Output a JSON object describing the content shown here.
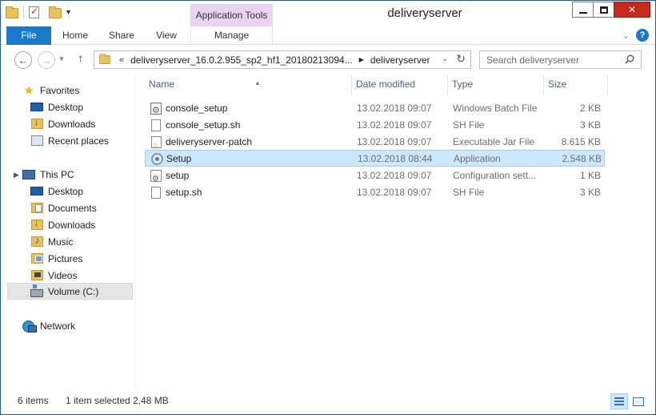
{
  "window": {
    "title": "deliveryserver",
    "context_tab_header": "Application Tools"
  },
  "ribbon": {
    "tabs": [
      {
        "label": "File"
      },
      {
        "label": "Home"
      },
      {
        "label": "Share"
      },
      {
        "label": "View"
      },
      {
        "label": "Manage"
      }
    ]
  },
  "navbar": {
    "breadcrumb_lead": "«",
    "breadcrumbs": [
      {
        "label": "deliveryserver_16.0.2.955_sp2_hf1_20180213094..."
      },
      {
        "label": "deliveryserver"
      }
    ],
    "search_placeholder": "Search deliveryserver"
  },
  "nav_pane": {
    "favorites": {
      "label": "Favorites",
      "items": [
        {
          "label": "Desktop"
        },
        {
          "label": "Downloads"
        },
        {
          "label": "Recent places"
        }
      ]
    },
    "this_pc": {
      "label": "This PC",
      "items": [
        {
          "label": "Desktop"
        },
        {
          "label": "Documents"
        },
        {
          "label": "Downloads"
        },
        {
          "label": "Music"
        },
        {
          "label": "Pictures"
        },
        {
          "label": "Videos"
        },
        {
          "label": "Volume (C:)"
        }
      ]
    },
    "network": {
      "label": "Network"
    }
  },
  "file_list": {
    "columns": {
      "name": "Name",
      "date": "Date modified",
      "type": "Type",
      "size": "Size"
    },
    "rows": [
      {
        "name": "console_setup",
        "date": "13.02.2018 09:07",
        "type": "Windows Batch File",
        "size": "2 KB",
        "icon": "batch-file-icon"
      },
      {
        "name": "console_setup.sh",
        "date": "13.02.2018 09:07",
        "type": "SH File",
        "size": "3 KB",
        "icon": "sh-file-icon"
      },
      {
        "name": "deliveryserver-patch",
        "date": "13.02.2018 09:07",
        "type": "Executable Jar File",
        "size": "8.615 KB",
        "icon": "jar-file-icon"
      },
      {
        "name": "Setup",
        "date": "13.02.2018 08:44",
        "type": "Application",
        "size": "2.548 KB",
        "icon": "application-icon",
        "selected": true
      },
      {
        "name": "setup",
        "date": "13.02.2018 09:07",
        "type": "Configuration sett...",
        "size": "1 KB",
        "icon": "config-file-icon"
      },
      {
        "name": "setup.sh",
        "date": "13.02.2018 09:07",
        "type": "SH File",
        "size": "3 KB",
        "icon": "sh-file-icon"
      }
    ]
  },
  "status_bar": {
    "item_count": "6 items",
    "selection": "1 item selected",
    "selection_size": "2,48 MB"
  },
  "colors": {
    "accent": "#1979ca",
    "context_tab": "#e8d4f0",
    "selection": "#cce8ff",
    "close_button": "#c42b1c"
  }
}
